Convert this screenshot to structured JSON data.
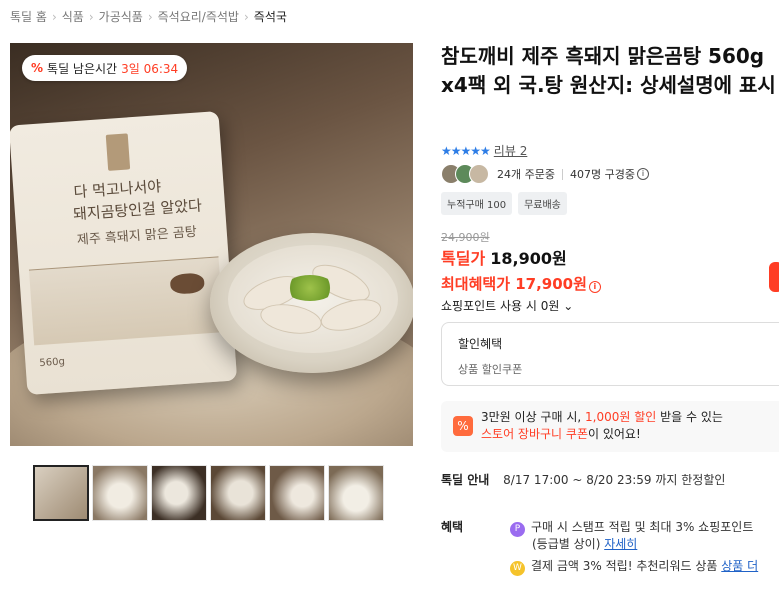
{
  "breadcrumb": [
    "톡딜 홈",
    "식품",
    "가공식품",
    "즉석요리/즉석밥",
    "즉석국"
  ],
  "image": {
    "deal_badge_icon": "%",
    "deal_badge_label": "톡딜 남은시간",
    "deal_badge_time": "3일 06:34",
    "pouch_line1": "다 먹고나서야",
    "pouch_line2": "돼지곰탕인걸 알았다",
    "pouch_line3": "제주 흑돼지 맑은 곰탕",
    "pouch_weight": "560g"
  },
  "thumbnails_count": 6,
  "product": {
    "title": "참도깨비 제주 흑돼지 맑은곰탕 560g x4팩 외 국.탕 원산지: 상세설명에 표시",
    "stars": "★★★★★",
    "review_label": "리뷰 2",
    "order_count": "24개 주문중",
    "viewer_count": "407명 구경중",
    "chips": [
      "누적구매 100",
      "무료배송"
    ],
    "original_price": "24,900원",
    "deal_label": "톡딜가",
    "deal_price": "18,900원",
    "max_benefit": "최대혜택가 17,900원",
    "point_use": "쇼핑포인트 사용 시 0원"
  },
  "discount": {
    "title": "할인혜택",
    "sub": "상품 할인쿠폰"
  },
  "coupon": {
    "icon": "%",
    "pre": "3만원 이상 구매 시, ",
    "amount": "1,000원 할인",
    "mid": " 받을 수 있는",
    "link": "스토어 장바구니 쿠폰",
    "post": "이 있어요!"
  },
  "deal_info": {
    "label": "톡딜 안내",
    "value": "8/17 17:00 ~ 8/20 23:59 까지 한정할인"
  },
  "benefits": {
    "label": "혜택",
    "row1": "구매 시 스탬프 적립 및 최대 3% 쇼핑포인트",
    "row1b_text": "(등급별 상이) ",
    "row1b_link": "자세히",
    "row2_text": "결제 금액 3% 적립! 추천리워드 상품 ",
    "row2_link": "상품 더"
  },
  "colors": {
    "accent": "#ff3d24",
    "star": "#2d7de6",
    "link": "#2062c7"
  }
}
